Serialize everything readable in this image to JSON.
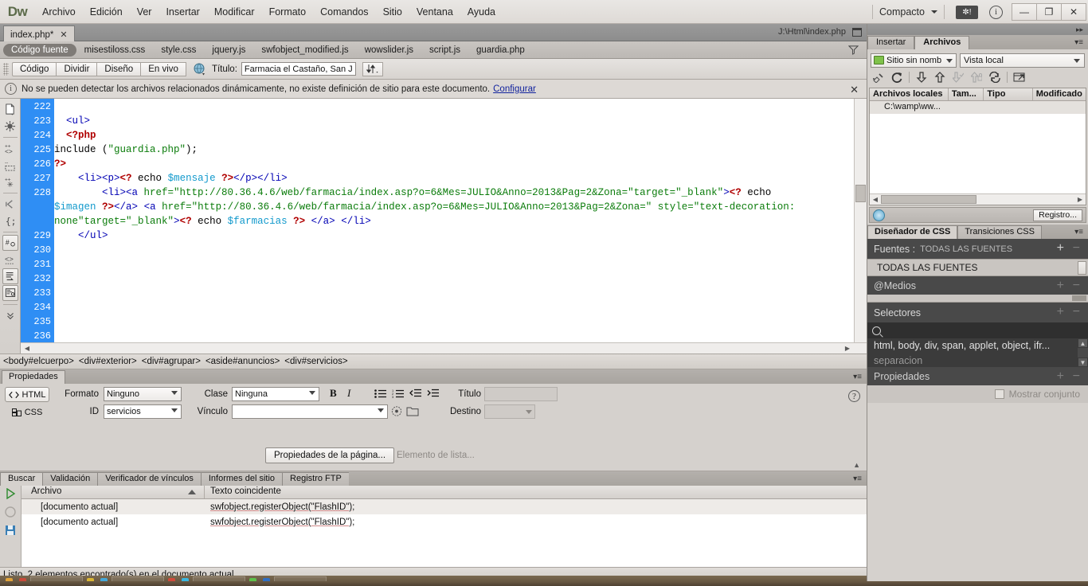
{
  "app": {
    "logo": "Dw",
    "menus": [
      "Archivo",
      "Edición",
      "Ver",
      "Insertar",
      "Modificar",
      "Formato",
      "Comandos",
      "Sitio",
      "Ventana",
      "Ayuda"
    ],
    "workspace_label": "Compacto",
    "extension_badge": "✼!",
    "info_icon": "i",
    "window_buttons": {
      "minimize": "—",
      "restore": "❐",
      "close": "✕"
    }
  },
  "document": {
    "tab_label": "index.php*",
    "tab_close": "✕",
    "path": "J:\\Html\\index.php",
    "restore_icon": "restore-icon"
  },
  "related_files": {
    "items": [
      {
        "label": "Código fuente",
        "active": true
      },
      {
        "label": "misestiloss.css",
        "active": false
      },
      {
        "label": "style.css",
        "active": false
      },
      {
        "label": "jquery.js",
        "active": false
      },
      {
        "label": "swfobject_modified.js",
        "active": false
      },
      {
        "label": "wowslider.js",
        "active": false
      },
      {
        "label": "script.js",
        "active": false
      },
      {
        "label": "guardia.php",
        "active": false
      }
    ],
    "filter_icon": "filter-icon"
  },
  "view_toolbar": {
    "buttons": [
      "Código",
      "Dividir",
      "Diseño",
      "En vivo"
    ],
    "globe_icon": "globe-icon",
    "title_label": "Título:",
    "title_value": "Farmacia el Castaño, San Juar",
    "filetransfer_icon": "upload-download-icon"
  },
  "warning": {
    "icon": "info-icon",
    "text": "No se pueden detectar los archivos relacionados dinámicamente, no existe definición de sitio para este documento.",
    "link": "Configurar",
    "close": "✕"
  },
  "code_tools": {
    "icons": [
      "open-documents-icon",
      "highlight-invalid-code-icon",
      "apply-comment-icon",
      "remove-comment-icon",
      "wrap-tag-icon",
      "recent-snippets-icon",
      "move-or-convert-css-icon",
      "line-numbers-icon",
      "collapse-full-tag-icon",
      "collapse-selection-icon",
      "expand-all-icon",
      "format-source-code-icon",
      "more-icon"
    ]
  },
  "editor": {
    "first_line": 222,
    "lines": [
      {
        "n": 222,
        "tokens": []
      },
      {
        "n": 223,
        "tokens": [
          {
            "t": "  ",
            "c": "plain"
          },
          {
            "t": "<ul>",
            "c": "tag"
          }
        ]
      },
      {
        "n": 224,
        "tokens": [
          {
            "t": "  ",
            "c": "plain"
          },
          {
            "t": "<?php",
            "c": "php"
          }
        ]
      },
      {
        "n": 225,
        "tokens": [
          {
            "t": "include (",
            "c": "plain"
          },
          {
            "t": "\"guardia.php\"",
            "c": "str"
          },
          {
            "t": ");",
            "c": "plain"
          }
        ]
      },
      {
        "n": 226,
        "tokens": [
          {
            "t": "?>",
            "c": "php"
          }
        ]
      },
      {
        "n": 227,
        "tokens": [
          {
            "t": "    ",
            "c": "plain"
          },
          {
            "t": "<li><p>",
            "c": "tag"
          },
          {
            "t": "<?",
            "c": "php"
          },
          {
            "t": " echo ",
            "c": "plain"
          },
          {
            "t": "$mensaje",
            "c": "var"
          },
          {
            "t": " ",
            "c": "plain"
          },
          {
            "t": "?>",
            "c": "php"
          },
          {
            "t": "</p></li>",
            "c": "tag"
          }
        ]
      },
      {
        "n": 228,
        "tokens": [
          {
            "t": "        ",
            "c": "plain"
          },
          {
            "t": "<li><a ",
            "c": "tag"
          },
          {
            "t": "href=",
            "c": "attr"
          },
          {
            "t": "\"http://80.36.4.6/web/farmacia/index.asp?o=6&Mes=JULIO&Anno=2013&Pag=2&Zona=\"",
            "c": "str"
          },
          {
            "t": "target=",
            "c": "attr"
          },
          {
            "t": "\"_blank\"",
            "c": "str"
          },
          {
            "t": ">",
            "c": "tag"
          },
          {
            "t": "<?",
            "c": "php"
          },
          {
            "t": " echo ",
            "c": "plain"
          }
        ]
      },
      {
        "n": null,
        "tokens": [
          {
            "t": "$imagen",
            "c": "var"
          },
          {
            "t": " ",
            "c": "plain"
          },
          {
            "t": "?>",
            "c": "php"
          },
          {
            "t": "</a>",
            "c": "tag"
          },
          {
            "t": " ",
            "c": "plain"
          },
          {
            "t": "<a ",
            "c": "tag"
          },
          {
            "t": "href=",
            "c": "attr"
          },
          {
            "t": "\"http://80.36.4.6/web/farmacia/index.asp?o=6&Mes=JULIO&Anno=2013&Pag=2&Zona=\"",
            "c": "str"
          },
          {
            "t": " ",
            "c": "plain"
          },
          {
            "t": "style=",
            "c": "attr"
          },
          {
            "t": "\"text-decoration:",
            "c": "str"
          }
        ]
      },
      {
        "n": null,
        "tokens": [
          {
            "t": "none\"",
            "c": "str"
          },
          {
            "t": "target=",
            "c": "attr"
          },
          {
            "t": "\"_blank\"",
            "c": "str"
          },
          {
            "t": ">",
            "c": "tag"
          },
          {
            "t": "<?",
            "c": "php"
          },
          {
            "t": " echo ",
            "c": "plain"
          },
          {
            "t": "$farmacias",
            "c": "var"
          },
          {
            "t": " ",
            "c": "plain"
          },
          {
            "t": "?>",
            "c": "php"
          },
          {
            "t": " ",
            "c": "plain"
          },
          {
            "t": "</a>",
            "c": "tag"
          },
          {
            "t": " ",
            "c": "plain"
          },
          {
            "t": "</li>",
            "c": "tag"
          }
        ]
      },
      {
        "n": 229,
        "tokens": [
          {
            "t": "    ",
            "c": "plain"
          },
          {
            "t": "</ul>",
            "c": "tag"
          }
        ]
      },
      {
        "n": 230,
        "tokens": []
      },
      {
        "n": 231,
        "tokens": []
      },
      {
        "n": 232,
        "tokens": []
      },
      {
        "n": 233,
        "tokens": []
      },
      {
        "n": 234,
        "tokens": []
      },
      {
        "n": 235,
        "tokens": []
      },
      {
        "n": 236,
        "tokens": []
      }
    ]
  },
  "tag_selector": {
    "tags": [
      "<body#elcuerpo>",
      "<div#exterior>",
      "<div#agrupar>",
      "<aside#anuncios>",
      "<div#servicios>"
    ]
  },
  "properties": {
    "panel_tab": "Propiedades",
    "html_button": "HTML",
    "css_button": "CSS",
    "formato_label": "Formato",
    "formato_value": "Ninguno",
    "id_label": "ID",
    "id_value": "servicios",
    "clase_label": "Clase",
    "clase_value": "Ninguna",
    "vinculo_label": "Vínculo",
    "vinculo_value": "",
    "bold": "B",
    "italic": "I",
    "list_icons": [
      "unordered-list-icon",
      "ordered-list-icon",
      "outdent-icon",
      "indent-icon"
    ],
    "titulo_label": "Título",
    "titulo_value": "",
    "destino_label": "Destino",
    "destino_value": "",
    "page_props_button": "Propiedades de la página...",
    "list_item_button": "Elemento de lista...",
    "help_icon": "help-icon",
    "browse_icon": "browse-folder-icon",
    "point_to_file_icon": "point-to-file-icon"
  },
  "results": {
    "tabs": [
      "Buscar",
      "Validación",
      "Verificador de vínculos",
      "Informes del sitio",
      "Registro FTP"
    ],
    "active_tab": "Buscar",
    "side_icons": [
      "run-search-icon",
      "stop-icon",
      "save-report-icon"
    ],
    "columns": [
      "Archivo",
      "Texto coincidente"
    ],
    "rows": [
      {
        "archivo": "[documento actual]",
        "texto": "swfobject.registerObject(\"FlashID\");"
      },
      {
        "archivo": "[documento actual]",
        "texto": "swfobject.registerObject(\"FlashID\");"
      }
    ]
  },
  "status": {
    "text": "Listo. 2 elementos encontrado(s) en el documento actual."
  },
  "dock": {
    "tabs": [
      {
        "label": "Insertar",
        "active": false
      },
      {
        "label": "Archivos",
        "active": true
      }
    ],
    "panel_menu_icon": "panel-menu-icon",
    "files": {
      "site_selector": "Sitio sin nomb",
      "view_selector": "Vista local",
      "toolbar_icons": [
        "connect-to-remote-icon",
        "refresh-icon",
        "get-files-icon",
        "put-files-icon",
        "check-out-icon",
        "check-in-icon",
        "synchronize-icon",
        "expand-panel-icon"
      ],
      "columns": [
        "Archivos locales",
        "Tam...",
        "Tipo",
        "Modificado"
      ],
      "rows": [
        {
          "name": "C:\\wamp\\ww..."
        }
      ],
      "log_button": "Registro...",
      "globe_icon": "globe-icon"
    },
    "css_designer": {
      "tabs": [
        {
          "label": "Diseñador de CSS",
          "active": true
        },
        {
          "label": "Transiciones CSS",
          "active": false
        }
      ],
      "sources_header": "Fuentes :",
      "sources_header_value": "TODAS LAS FUENTES",
      "sources_items": [
        "TODAS LAS FUENTES"
      ],
      "media_header": "@Medios",
      "selectors_header": "Selectores",
      "search_placeholder": "",
      "selector_items": [
        "html, body, div, span, applet, object, ifr...",
        "separacion"
      ],
      "properties_header": "Propiedades",
      "show_set_label": "Mostrar conjunto",
      "add_icon": "plus-icon",
      "remove_icon": "minus-icon"
    }
  },
  "colors": {
    "gutter_blue": "#2f8ef4",
    "panel_gray": "#d5d1cd",
    "dark_panel": "#494949",
    "link_blue": "#12239e"
  }
}
